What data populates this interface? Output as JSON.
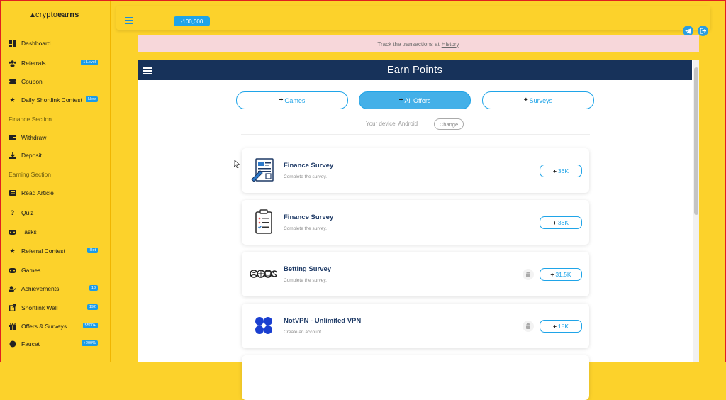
{
  "brand": {
    "logo_light": "crypto",
    "logo_bold": "earns"
  },
  "sidebar": {
    "items": [
      {
        "label": "Dashboard",
        "icon": "dashboard-icon",
        "badge": ""
      },
      {
        "label": "Referrals",
        "icon": "users-icon",
        "badge": "1 Level"
      },
      {
        "label": "Coupon",
        "icon": "coupon-icon",
        "badge": ""
      },
      {
        "label": "Daily Shortlink Contest",
        "icon": "star-icon",
        "badge": "New"
      },
      {
        "label": "Withdraw",
        "icon": "wallet-icon",
        "badge": ""
      },
      {
        "label": "Deposit",
        "icon": "download-icon",
        "badge": ""
      },
      {
        "label": "Read Article",
        "icon": "article-icon",
        "badge": ""
      },
      {
        "label": "Quiz",
        "icon": "question-icon",
        "badge": ""
      },
      {
        "label": "Tasks",
        "icon": "gamepad-icon",
        "badge": ""
      },
      {
        "label": "Referral Contest",
        "icon": "star-icon",
        "badge": "Hot"
      },
      {
        "label": "Games",
        "icon": "gamepad-icon",
        "badge": ""
      },
      {
        "label": "Achievements",
        "icon": "user-check-icon",
        "badge": "13"
      },
      {
        "label": "Shortlink Wall",
        "icon": "external-link-icon",
        "badge": "192"
      },
      {
        "label": "Offers & Surveys",
        "icon": "gift-icon",
        "badge": "$500+"
      },
      {
        "label": "Faucet",
        "icon": "faucet-icon",
        "badge": "+200%"
      }
    ],
    "sections": {
      "finance": "Finance Section",
      "earning": "Earning Section"
    }
  },
  "topbar": {
    "balance": "-100,000"
  },
  "notice": {
    "text": "Track the transactions at",
    "link": "History"
  },
  "panel": {
    "title": "Earn Points",
    "tabs": [
      {
        "label": "Games"
      },
      {
        "label": "All Offers"
      },
      {
        "label": "Surveys"
      }
    ],
    "device_text": "Your device:  Android",
    "change_label": "Change"
  },
  "offers": [
    {
      "name": "Finance Survey",
      "desc": "Complete the survey.",
      "points": "36K",
      "platform": ""
    },
    {
      "name": "Finance Survey",
      "desc": "Complete the survey.",
      "points": "36K",
      "platform": ""
    },
    {
      "name": "Betting Survey",
      "desc": "Complete the survey.",
      "points": "31.5K",
      "platform": "android"
    },
    {
      "name": "NotVPN - Unlimited VPN",
      "desc": "Create an account.",
      "points": "18K",
      "platform": "android"
    }
  ],
  "colors": {
    "accent": "#1fa4e8",
    "sidebar_bg": "#fcd22b",
    "header_bg": "#17325a",
    "notice_bg": "#f7d7da"
  }
}
